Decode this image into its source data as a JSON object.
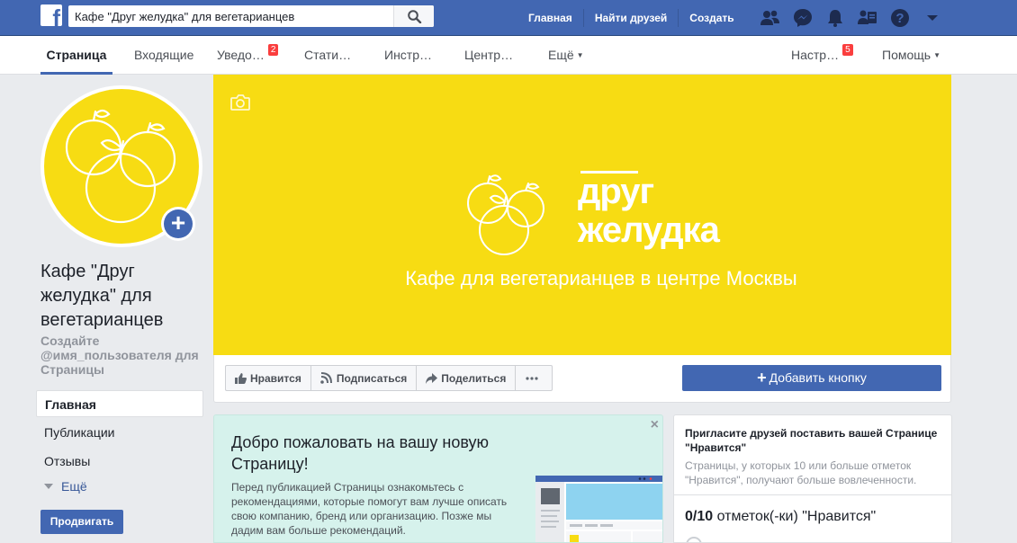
{
  "topbar": {
    "search_value": "Кафе \"Друг желудка\" для вегетарианцев",
    "nav": [
      "Главная",
      "Найти друзей",
      "Создать"
    ]
  },
  "pagebar": {
    "tabs": [
      {
        "label": "Страница"
      },
      {
        "label": "Входящие"
      },
      {
        "label": "Уведо…",
        "badge": "2"
      },
      {
        "label": "Стати…"
      },
      {
        "label": "Инстр…"
      },
      {
        "label": "Центр…"
      },
      {
        "label": "Ещё"
      }
    ],
    "settings": {
      "label": "Настр…",
      "badge": "5"
    },
    "help": {
      "label": "Помощь"
    }
  },
  "page": {
    "name": "Кафе \"Друг желудка\" для вегетарианцев",
    "username_prompt": "Создайте @имя_пользователя для Страницы"
  },
  "leftnav": {
    "items": [
      "Главная",
      "Публикации",
      "Отзывы"
    ],
    "more": "Ещё",
    "promote": "Продвигать"
  },
  "cover": {
    "brand_line1": "друг",
    "brand_line2": "желудка",
    "subtitle": "Кафе для вегетарианцев в центре Москвы",
    "bg_color": "#f7dc13"
  },
  "actions": {
    "like": "Нравится",
    "follow": "Подписаться",
    "share": "Поделиться",
    "add_button": "Добавить кнопку"
  },
  "welcome": {
    "title": "Добро пожаловать на вашу новую Страницу!",
    "text": "Перед публикацией Страницы ознакомьтесь с рекомендациями, которые помогут вам лучше описать свою компанию, бренд или организацию. Позже мы дадим вам больше рекомендаций."
  },
  "invite": {
    "title": "Пригласите друзей поставить вашей Странице \"Нравится\"",
    "text": "Страницы, у которых 10 или больше отметок \"Нравится\", получают больше вовлеченности.",
    "count": "0/10",
    "count_label": "отметок(-ки) \"Нравится\""
  },
  "icons": {
    "logo": "facebook-logo",
    "search": "search-icon",
    "friends": "friends-icon",
    "messenger": "messenger-icon",
    "notifications": "bell-icon",
    "people": "people-icon",
    "help": "help-icon",
    "menu": "dropdown-icon",
    "camera": "camera-icon"
  },
  "colors": {
    "brand_blue": "#4267b2",
    "cover_yellow": "#f7dc13",
    "badge_red": "#fa3e3e",
    "welcome_bg": "#d6f2ec"
  }
}
